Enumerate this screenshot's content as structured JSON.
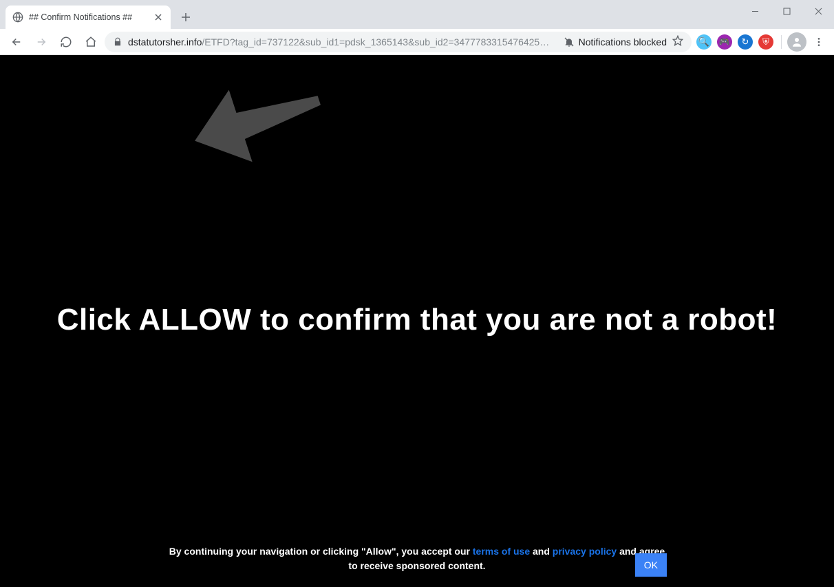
{
  "window": {
    "tab_title": "## Confirm Notifications ##"
  },
  "toolbar": {
    "url_host": "dstatutorsher.info",
    "url_path": "/ETFD?tag_id=737122&sub_id1=pdsk_1365143&sub_id2=3477783315476425…",
    "notifications_blocked_label": "Notifications blocked"
  },
  "extensions": [
    {
      "name": "search-ext",
      "bg": "#4fc3f7",
      "glyph": "🔍"
    },
    {
      "name": "games-ext",
      "bg": "#9c27b0",
      "glyph": "🎮"
    },
    {
      "name": "sync-ext",
      "bg": "#1976d2",
      "glyph": "↻"
    },
    {
      "name": "shield-ext",
      "bg": "#e53935",
      "glyph": "⛨"
    }
  ],
  "page": {
    "headline": "Click ALLOW to confirm that you are not a robot!",
    "footer_prefix": "By continuing your navigation or clicking \"Allow\", you accept our ",
    "terms_link": "terms of use",
    "footer_mid": " and ",
    "privacy_link": "privacy policy",
    "footer_suffix": " and agree",
    "footer_line2": "to receive sponsored content.",
    "ok_label": "OK"
  }
}
